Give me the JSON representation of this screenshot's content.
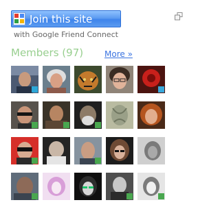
{
  "join_button": {
    "label": "Join this site"
  },
  "subtitle": "with Google Friend Connect",
  "members": {
    "heading_label": "Members",
    "count": "(97)",
    "more_label": "More »"
  }
}
